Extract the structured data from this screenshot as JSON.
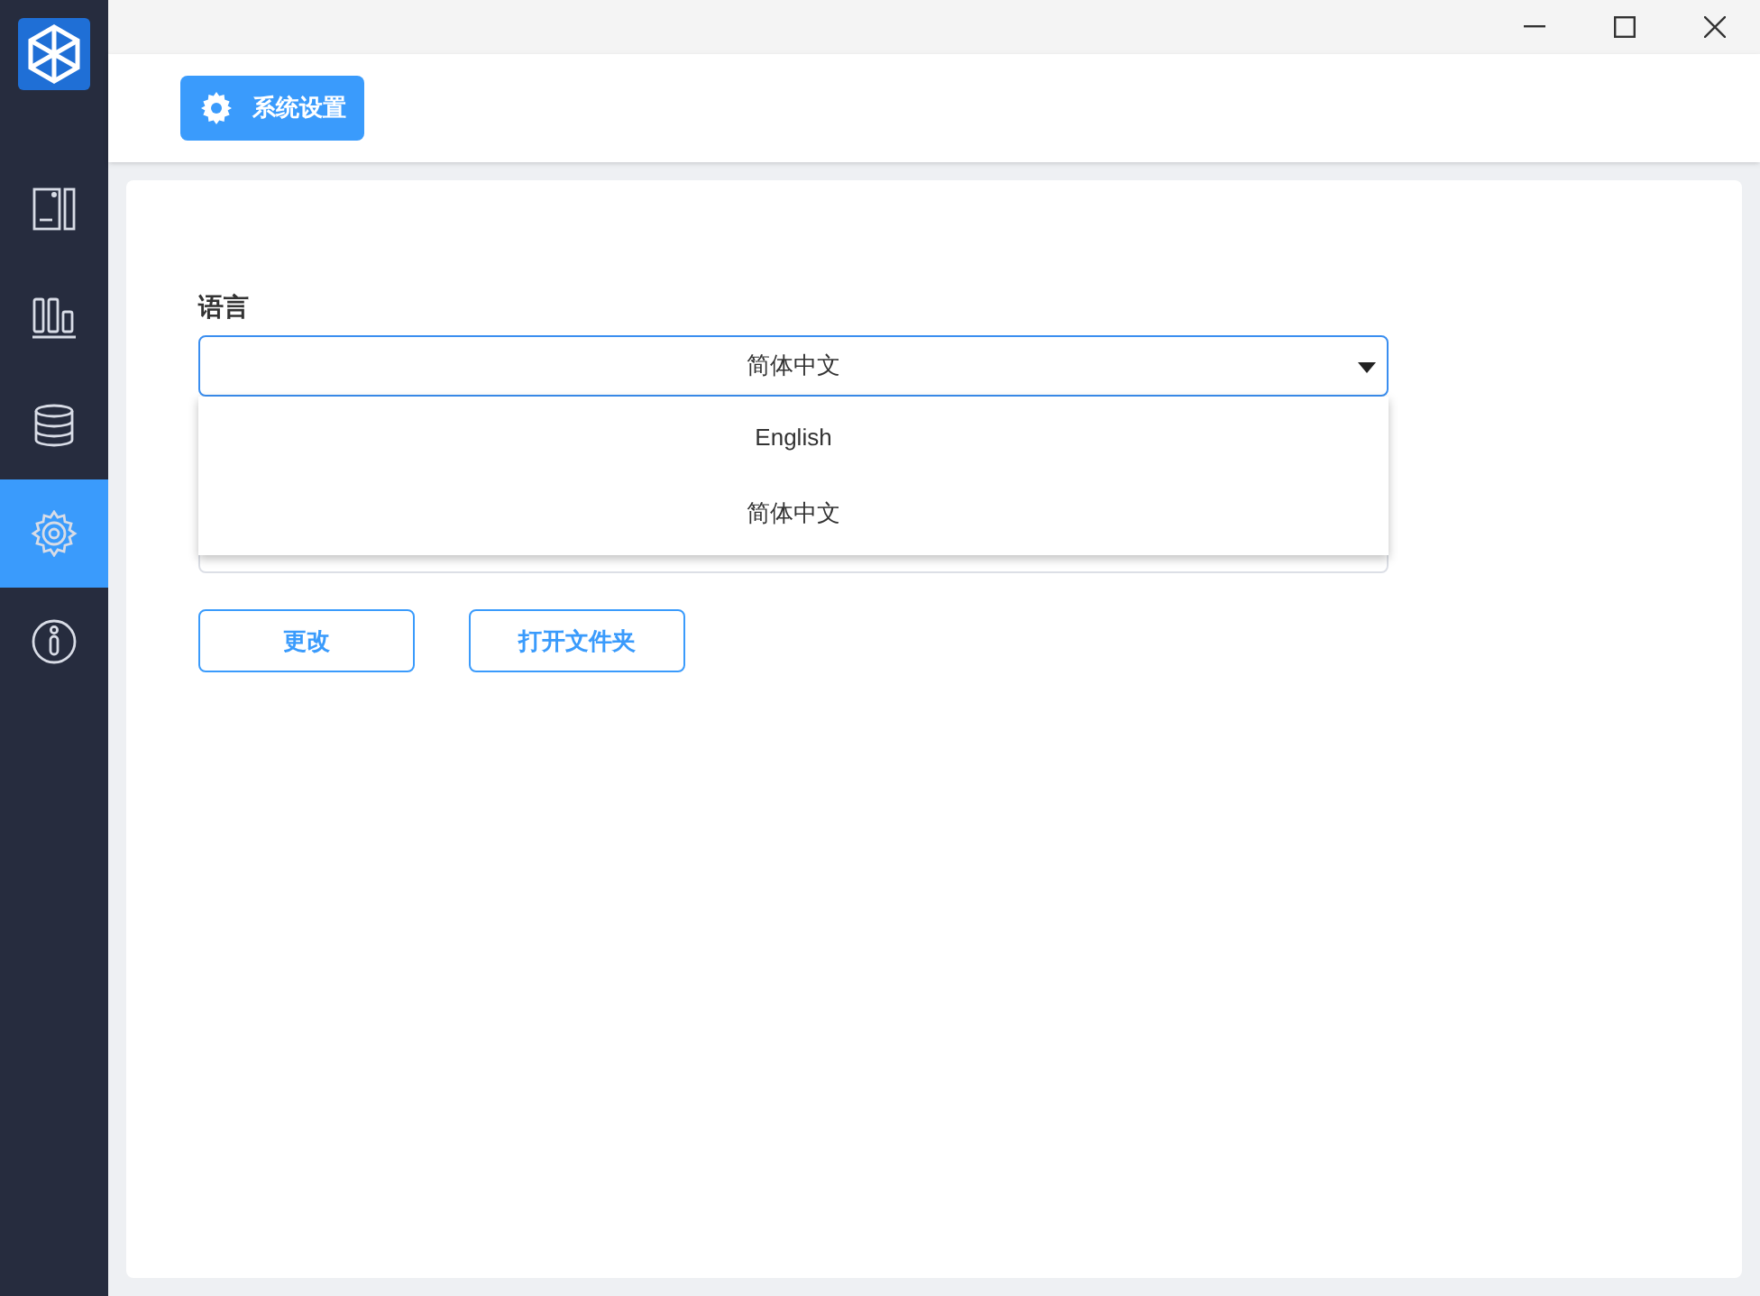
{
  "sidebar": {
    "items": [
      {
        "kind": "device",
        "selected": false
      },
      {
        "kind": "chart",
        "selected": false
      },
      {
        "kind": "database",
        "selected": false
      },
      {
        "kind": "settings",
        "selected": true
      },
      {
        "kind": "info",
        "selected": false
      }
    ]
  },
  "header": {
    "tab": "系统设置"
  },
  "language": {
    "label": "语言",
    "value": "简体中文",
    "expanded": true,
    "options": [
      "English",
      "简体中文"
    ]
  },
  "buttons": [
    "更改",
    "打开文件夹"
  ]
}
